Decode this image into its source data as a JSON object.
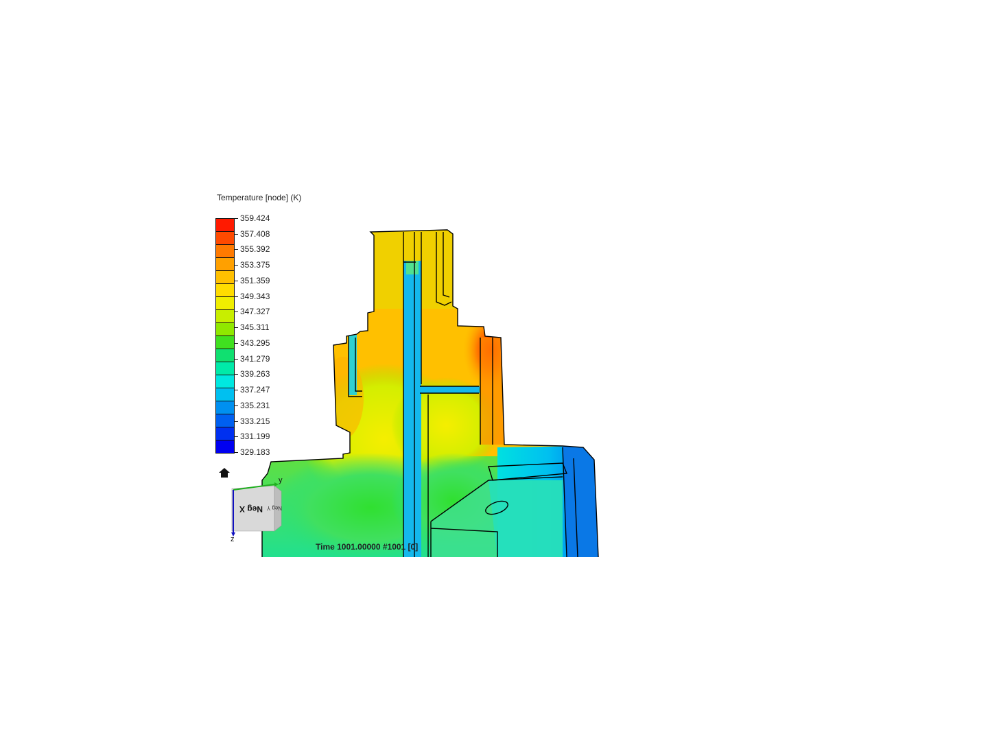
{
  "legend": {
    "title": "Temperature [node] (K)",
    "labels": [
      "359.424",
      "357.408",
      "355.392",
      "353.375",
      "351.359",
      "349.343",
      "347.327",
      "345.311",
      "343.295",
      "341.279",
      "339.263",
      "337.247",
      "335.231",
      "333.215",
      "331.199",
      "329.183"
    ],
    "colors": [
      "#ff1a00",
      "#ff4a00",
      "#ff7a00",
      "#ffa000",
      "#ffc000",
      "#ffdc00",
      "#f0ee00",
      "#c8ee00",
      "#90e800",
      "#40e020",
      "#10e070",
      "#00eaa8",
      "#00e8e0",
      "#00c0f0",
      "#0090f0",
      "#0060f0",
      "#0030f0",
      "#0000f0"
    ]
  },
  "triad": {
    "cube_label": "Neg X",
    "side_label": "Neg Y",
    "axis_y": "y",
    "axis_z": "z"
  },
  "time_label": "Time 1001.00000  #1001 [0]",
  "colors": {
    "background": "#ffffff",
    "outline": "#000000"
  }
}
